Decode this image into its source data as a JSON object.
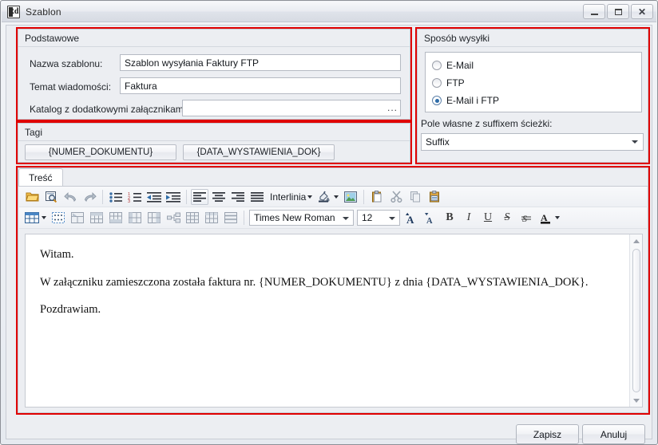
{
  "window": {
    "title": "Szablon",
    "icon": "app-icon",
    "buttons": {
      "minimize": "minimize-icon",
      "maximize": "maximize-icon",
      "close": "close-icon"
    }
  },
  "basic_group": {
    "title": "Podstawowe",
    "fields": [
      {
        "label": "Nazwa szablonu:",
        "value": "Szablon wysyłania Faktury FTP"
      },
      {
        "label": "Temat wiadomości:",
        "value": "Faktura"
      },
      {
        "label": "Katalog z dodatkowymi załącznikami:",
        "value": "",
        "browse": "..."
      }
    ]
  },
  "tags_group": {
    "title": "Tagi",
    "tags": [
      "{NUMER_DOKUMENTU}",
      "{DATA_WYSTAWIENIA_DOK}"
    ]
  },
  "send_group": {
    "title": "Sposób wysyłki",
    "options": [
      {
        "label": "E-Mail",
        "checked": false
      },
      {
        "label": "FTP",
        "checked": false
      },
      {
        "label": "E-Mail i FTP",
        "checked": true
      }
    ],
    "suffix_label": "Pole własne z suffixem ścieżki:",
    "suffix_value": "Suffix"
  },
  "content_tab": {
    "tab_label": "Treść",
    "toolbar_row1": [
      {
        "name": "open-folder-icon",
        "kind": "icon"
      },
      {
        "name": "print-preview-icon",
        "kind": "icon"
      },
      {
        "name": "undo-icon",
        "kind": "icon"
      },
      {
        "name": "redo-icon",
        "kind": "icon"
      },
      {
        "name": "separator",
        "kind": "sep"
      },
      {
        "name": "bullet-list-icon",
        "kind": "icon"
      },
      {
        "name": "numbered-list-icon",
        "kind": "icon"
      },
      {
        "name": "decrease-indent-icon",
        "kind": "icon"
      },
      {
        "name": "increase-indent-icon",
        "kind": "icon"
      },
      {
        "name": "separator",
        "kind": "sep"
      },
      {
        "name": "align-left-icon",
        "kind": "icon"
      },
      {
        "name": "align-center-icon",
        "kind": "icon"
      },
      {
        "name": "align-right-icon",
        "kind": "icon"
      },
      {
        "name": "align-justify-icon",
        "kind": "icon"
      },
      {
        "name": "line-spacing-label",
        "kind": "text",
        "label": "Interlinia"
      },
      {
        "name": "highlight-color-icon",
        "kind": "icon"
      },
      {
        "name": "insert-image-icon",
        "kind": "icon"
      },
      {
        "name": "separator",
        "kind": "sep"
      },
      {
        "name": "paste-icon",
        "kind": "icon"
      },
      {
        "name": "cut-icon",
        "kind": "icon"
      },
      {
        "name": "copy-icon",
        "kind": "icon"
      },
      {
        "name": "paste-special-icon",
        "kind": "icon"
      }
    ],
    "toolbar_row2": {
      "table_icons": [
        "insert-table-icon",
        "table-properties-icon",
        "merge-cells-icon",
        "insert-row-above-icon",
        "insert-row-below-icon",
        "insert-column-left-icon",
        "insert-column-right-icon",
        "split-cells-icon",
        "delete-row-icon",
        "delete-column-icon",
        "table-borders-icon"
      ],
      "font_family": "Times New Roman",
      "font_size": "12",
      "format_icons": [
        "increase-font-size-icon",
        "decrease-font-size-icon",
        "bold-icon",
        "italic-icon",
        "underline-icon",
        "strikethrough-icon",
        "double-strikethrough-icon",
        "font-color-icon"
      ]
    },
    "body": {
      "paragraphs": [
        "Witam.",
        "W załączniku zamieszczona została faktura nr. {NUMER_DOKUMENTU} z dnia {DATA_WYSTAWIENIA_DOK}.",
        "Pozdrawiam."
      ]
    }
  },
  "footer": {
    "save_label": "Zapisz",
    "cancel_label": "Anuluj"
  },
  "colors": {
    "highlight": "#e00000",
    "accent": "#2d6ca8",
    "window_bg": "#eceef2"
  }
}
